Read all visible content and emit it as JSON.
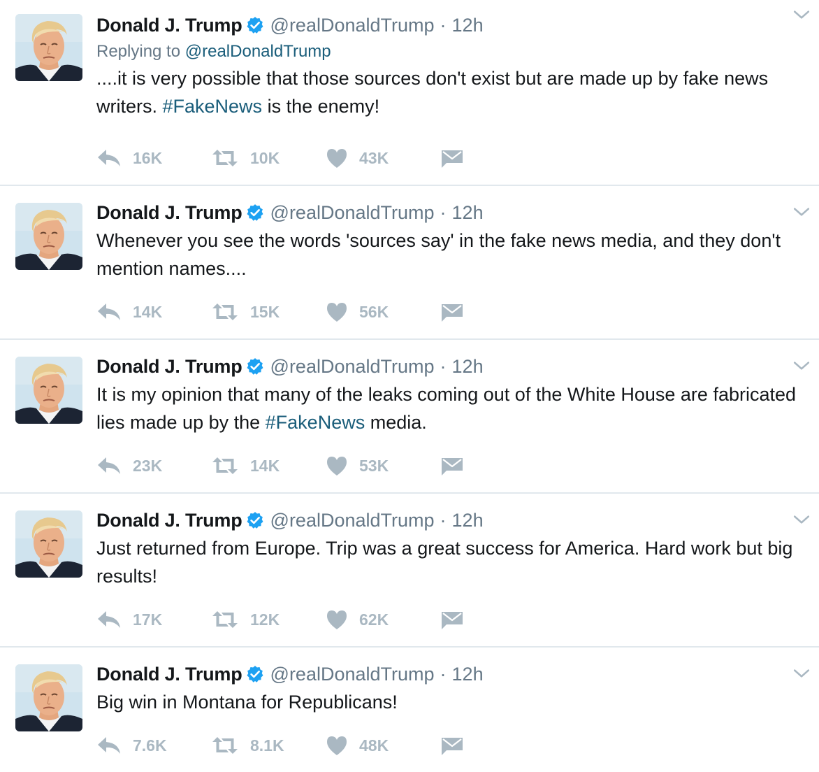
{
  "colors": {
    "link": "#1a5d7a",
    "verified": "#1da1f2",
    "muted": "#657786",
    "action_gray": "#aab8c2"
  },
  "icons": {
    "verified": "verified-badge-icon",
    "caret": "chevron-down-icon",
    "reply": "reply-icon",
    "retweet": "retweet-icon",
    "like": "heart-icon",
    "dm": "envelope-icon"
  },
  "tweets": [
    {
      "name": "Donald J. Trump",
      "handle": "@realDonaldTrump",
      "separator": "·",
      "time": "12h",
      "replying_label": "Replying to",
      "replying_handle": "@realDonaldTrump",
      "text_before": "....it is very possible that those sources don't exist but are made up by fake news writers. ",
      "hashtag": "#FakeNews",
      "text_after": " is the enemy!",
      "replies": "16K",
      "retweets": "10K",
      "likes": "43K"
    },
    {
      "name": "Donald J. Trump",
      "handle": "@realDonaldTrump",
      "separator": "·",
      "time": "12h",
      "text": "Whenever you see the words 'sources say' in the fake news media, and they don't mention names....",
      "replies": "14K",
      "retweets": "15K",
      "likes": "56K"
    },
    {
      "name": "Donald J. Trump",
      "handle": "@realDonaldTrump",
      "separator": "·",
      "time": "12h",
      "text_before": "It is my opinion that many of the leaks coming out of the White House are fabricated lies made up by the ",
      "hashtag": "#FakeNews",
      "text_after": " media.",
      "replies": "23K",
      "retweets": "14K",
      "likes": "53K"
    },
    {
      "name": "Donald J. Trump",
      "handle": "@realDonaldTrump",
      "separator": "·",
      "time": "12h",
      "text": "Just returned from Europe. Trip was a great success for America. Hard work but big results!",
      "replies": "17K",
      "retweets": "12K",
      "likes": "62K"
    },
    {
      "name": "Donald J. Trump",
      "handle": "@realDonaldTrump",
      "separator": "·",
      "time": "12h",
      "text": "Big win in Montana for Republicans!",
      "replies": "7.6K",
      "retweets": "8.1K",
      "likes": "48K"
    }
  ]
}
